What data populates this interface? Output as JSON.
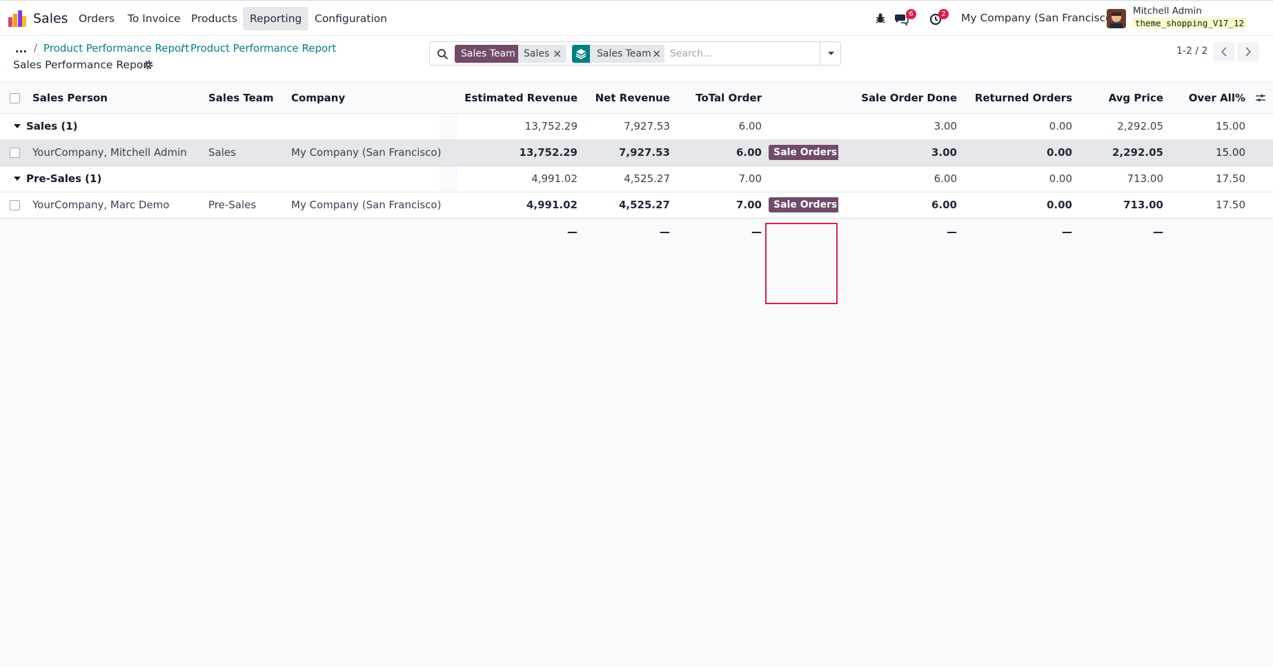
{
  "navbar": {
    "app_name": "Sales",
    "menu": [
      "Orders",
      "To Invoice",
      "Products",
      "Reporting",
      "Configuration"
    ],
    "messages_count": "6",
    "activities_count": "2",
    "company": "My Company (San Francisco)",
    "user_name": "Mitchell Admin",
    "db_name": "theme_shopping_V17_12"
  },
  "breadcrumb": {
    "dots": "...",
    "sep": "/",
    "items": [
      "Product Performance Report",
      "Product Performance Report"
    ],
    "current": "Sales Performance Report"
  },
  "search": {
    "facet1_label": "Sales Team",
    "facet1_value": "Sales",
    "facet2_value": "Sales Team",
    "remove_glyph": "×",
    "placeholder": "Search..."
  },
  "pager": {
    "text": "1-2 / 2"
  },
  "table": {
    "columns": [
      "Sales Person",
      "Sales Team",
      "Company",
      "Estimated Revenue",
      "Net Revenue",
      "ToTal Order",
      "",
      "Sale Order Done",
      "Returned Orders",
      "Avg Price",
      "Over All%"
    ],
    "groups": [
      {
        "name": "Sales (1)",
        "totals": [
          "13,752.29",
          "7,927.53",
          "6.00",
          "3.00",
          "0.00",
          "2,292.05",
          "15.00"
        ],
        "row": {
          "sales_person": "YourCompany, Mitchell Admin",
          "sales_team": "Sales",
          "company": "My Company (San Francisco)",
          "estimated_revenue": "13,752.29",
          "net_revenue": "7,927.53",
          "total_order": "6.00",
          "button": "Sale Orders",
          "sale_order_done": "3.00",
          "returned_orders": "0.00",
          "avg_price": "2,292.05",
          "over_all": "15.00"
        }
      },
      {
        "name": "Pre-Sales (1)",
        "totals": [
          "4,991.02",
          "4,525.27",
          "7.00",
          "6.00",
          "0.00",
          "713.00",
          "17.50"
        ],
        "row": {
          "sales_person": "YourCompany, Marc Demo",
          "sales_team": "Pre-Sales",
          "company": "My Company (San Francisco)",
          "estimated_revenue": "4,991.02",
          "net_revenue": "4,525.27",
          "total_order": "7.00",
          "button": "Sale Orders",
          "sale_order_done": "6.00",
          "returned_orders": "0.00",
          "avg_price": "713.00",
          "over_all": "17.50"
        }
      }
    ],
    "footer_dash": "—"
  }
}
